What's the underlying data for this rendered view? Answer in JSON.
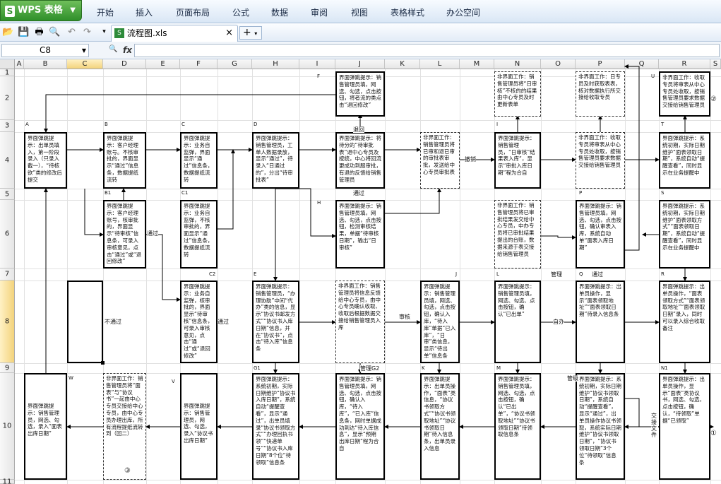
{
  "app": {
    "name": "WPS 表格",
    "logo": "S"
  },
  "menu": [
    "开始",
    "插入",
    "页面布局",
    "公式",
    "数据",
    "审阅",
    "视图",
    "表格样式",
    "办公空间"
  ],
  "toolbar": {
    "icons": [
      "open-icon",
      "save-icon",
      "print-icon",
      "print-preview-icon",
      "undo-icon",
      "redo-icon",
      "more-icon"
    ],
    "doc_tab": "流程图.xls",
    "close": "×",
    "new_tab": "+"
  },
  "formula_bar": {
    "cell_ref": "C8",
    "search_icon": "🔍",
    "fx": "fx",
    "content": ""
  },
  "columns": [
    "A",
    "B",
    "C",
    "D",
    "E",
    "F",
    "G",
    "H",
    "I",
    "J",
    "K",
    "L",
    "M",
    "N",
    "O",
    "P",
    "Q",
    "R",
    "S"
  ],
  "rows": [
    "1",
    "2",
    "3",
    "4",
    "5",
    "6",
    "7",
    "8",
    "9",
    "10",
    "11"
  ],
  "selected": {
    "column": "C",
    "row": "8"
  },
  "boxes": [
    {
      "id": "A-box",
      "tag": "A",
      "text": "界面弹跳提示：出单员填入，第一阶段录入（只录入截一），“待核欲”类的修改后提交"
    },
    {
      "id": "B-box",
      "tag": "B",
      "text": "界面弹跳提示：客户经理账号。不核审批的，界面显示“通过”信息条，数据提纸流转"
    },
    {
      "id": "C-box",
      "tag": "C",
      "text": "界面弹跳提示：业务自监弹，界面显示“通过”信息条，数据提纸流转"
    },
    {
      "id": "D-box",
      "tag": "D",
      "text": "界面弹跳提示：销售管理员，工单人数据录放，显示“通过”，待录入“日通过的”，分出“待审批表”"
    },
    {
      "id": "F-box",
      "tag": "F",
      "text": "界面弹跳提示：销售管理员填，网选、勾选，点击按钮，将者流的类点击“退回修改”"
    },
    {
      "id": "J1-box",
      "tag": "",
      "text": "界面弹跳提示：将待分的“待审批表”退中心专员及按统，中心将回流更成功到服审批，有退的反馈给销售管理员"
    },
    {
      "id": "sys1-box",
      "tag": "",
      "text": "非界面工作：销售管理员将已审和退已审的审批表审批，发送给中心专员审批表"
    },
    {
      "id": "I-box",
      "tag": "I",
      "text": "界面弹跳提示：销售管理员，“日审核”结果表入库“，显示“审批入库日期”程为合自"
    },
    {
      "id": "top-N-box",
      "tag": "",
      "text": "非界面工作：销售管理员将“日审核”不核的的结果由中心专员及时更新表单"
    },
    {
      "id": "top-P-box",
      "tag": "",
      "text": "非界面工作：日专员及时获取表表，核对数据执行所交接给收取专员"
    },
    {
      "id": "P-mid-box",
      "tag": "",
      "text": "非界面工作：收取专员将审表从中心专员处收取，按销售管理员要求数据交接给销售管理员"
    },
    {
      "id": "U-box",
      "tag": "U",
      "text": "界面弹跳提示：销售管理员填，网选、勾选、点击按钮；确认，“待领取”单据“已领取”"
    },
    {
      "id": "T-box",
      "tag": "T",
      "text": "界面弹跳提示：系统初期，实际日期维护“面表领取日期”，系统自动“提醒查看”，同时显示在业务提醒中"
    },
    {
      "id": "B1-box",
      "tag": "B1",
      "text": "界面弹跳提示：客户经理账号，核审批的，界面显示“待审核”信息条，可录入审核意见，点击“通过”或“退回修改”"
    },
    {
      "id": "C1-box",
      "tag": "C1",
      "text": "界面弹跳提示：业务自监弹，不核审批的，界面显示“通过”信息条，数据提纸流转"
    },
    {
      "id": "H-box",
      "tag": "H",
      "text": "界面弹跳提示：销售管理员填，网选、勾选，点击按钮，检测审核结果，单据“待审核日期”，输出“日审核”"
    },
    {
      "id": "N-mid-box",
      "tag": "",
      "text": "非界面工作：销售管理员将已审批结果发交给中心专员，中办专员将已审批结果提出的台账，数据来源于表交接给销售管理员"
    },
    {
      "id": "P-box",
      "tag": "P",
      "text": "界面弹跳提示：销售管理员填，网选、勾选，点击按钮，确认审表入库，系统自动单“面表入库日期”"
    },
    {
      "id": "S-box",
      "tag": "S",
      "text": "界面弹跳提示：系统初期，实际日期维护“面表领取方式”“面表领取日期”，系统自动“提醒查看”，同时显示在业务提醒中"
    },
    {
      "id": "C2-box",
      "tag": "C2",
      "text": "界面弹跳提示：业务自监弹，核审批的，界面显示“待审核”信息条，可录入审核意见，点击“通过”或“退回修改”"
    },
    {
      "id": "E-box",
      "tag": "E",
      "text": "界面弹跳提示：销售管理员，“办理协助”中间“代办”类的信息，显示“协议书邮发方式”“协议书入库日期”信息，并在“协议书”，点击“待入库”信息条"
    },
    {
      "id": "J-mid-box",
      "tag": "",
      "text": "非界面工作：销售管理员将信息反馈给中心专员，由中心专员确认收取、收取后根据数据交接给销售管理员入库"
    },
    {
      "id": "J8-box",
      "tag": "J",
      "text": "界面弹跳提示：销售管理员填，网选、勾选，点击按钮，确认入库，“待入库”单据“已入库”，“日审”类信息，显示“待出单”信息条"
    },
    {
      "id": "L-box",
      "tag": "L",
      "text": "界面弹跳提示：销售管理员填，网选、勾选、点击按钮，确认“已出单”"
    },
    {
      "id": "Q-box",
      "tag": "Q",
      "text": "界面弹跳提示：出单员操作，显示“面表领取地址”“面表领取日期”待录入信息条"
    },
    {
      "id": "R-box",
      "tag": "R",
      "text": "界面弹跳提示：出单员操作，“面表领取方式”“面表领取地址”“面表领取日期”录入，同时可以录入综合收取备注"
    },
    {
      "id": "W-box",
      "tag": "W",
      "text": "界面弹跳提示：销售管理员，网选、勾选，录入“面表出库日期”"
    },
    {
      "id": "non-ui-W-box",
      "tag": "",
      "text": "非界面工作：销售管理员将“面表”与“协议书”一起由中心专员交接给中心专员，由中心专员办理出库，所有流程提纸流转到（回二）"
    },
    {
      "id": "V-box",
      "tag": "V",
      "text": "界面弹跳提示：销售管理员，网选、勾选，录入“协议书出库日期”"
    },
    {
      "id": "G1-box",
      "tag": "G1",
      "text": "界面弹跳提示：系统初期，实际日期维护“协议书入库日期”，系统自动“提醒查看”，显示“通过”，出单员填录“协议书领取方式”“办理回执书领”“快递单号”“协议书入库日期”8个位“待领取”信息条"
    },
    {
      "id": "K-mid-box",
      "tag": "",
      "text": "界面弹跳提示：销售管理员填，网选、勾选，点击按钮，确认入库，“待入库”，“已入库”信息条，网时单据成功到达“待入库信息”，显示“预期出库日期”程为合自"
    },
    {
      "id": "K-box",
      "tag": "K",
      "text": "界面弹跳提示：出单员操作，“面表”类信息，“协议书领取方式”“协议书领取地址”“协议书领取日期”待入信息条，出单员录入信息"
    },
    {
      "id": "M-box",
      "tag": "M",
      "text": "界面弹跳提示：销售管理员填，网选、勾选，点击按钮，确认“已出单”，“协议书领取地址”“协议书领取日期”待领取信息条"
    },
    {
      "id": "N2-box",
      "tag": "",
      "text": "界面弹跳提示：系统初期，实际日期维护“协议书领取日期”，系统自动“提醒查看”，显示“通过”，出单员操作协议书领取，系统实际日期维护“协议书领取日期”，“协议书领取日期”3个位“待领取”信息条"
    },
    {
      "id": "N1-box",
      "tag": "N1",
      "text": "界面弹跳提示：出单员操作，显示“面表”类协议书，网选、勾选，点击按钮，确认，“待领取”单据“已领取”"
    }
  ],
  "connector_labels": {
    "tongguo1": "通过",
    "butongguo": "不通过",
    "tongguo2": "通过",
    "tuihui": "退回",
    "tongguo3": "通过",
    "tuihui2": "撤销",
    "shenhe": "审核",
    "guanli": "管理",
    "tongguo4": "通过",
    "guanli2": "管理G2",
    "ziban": "自办",
    "guanli3": "管级",
    "circle1": "①",
    "circle2": "②",
    "circle3": "③",
    "jiaowei": "交接文件",
    "shuju": "数据"
  }
}
